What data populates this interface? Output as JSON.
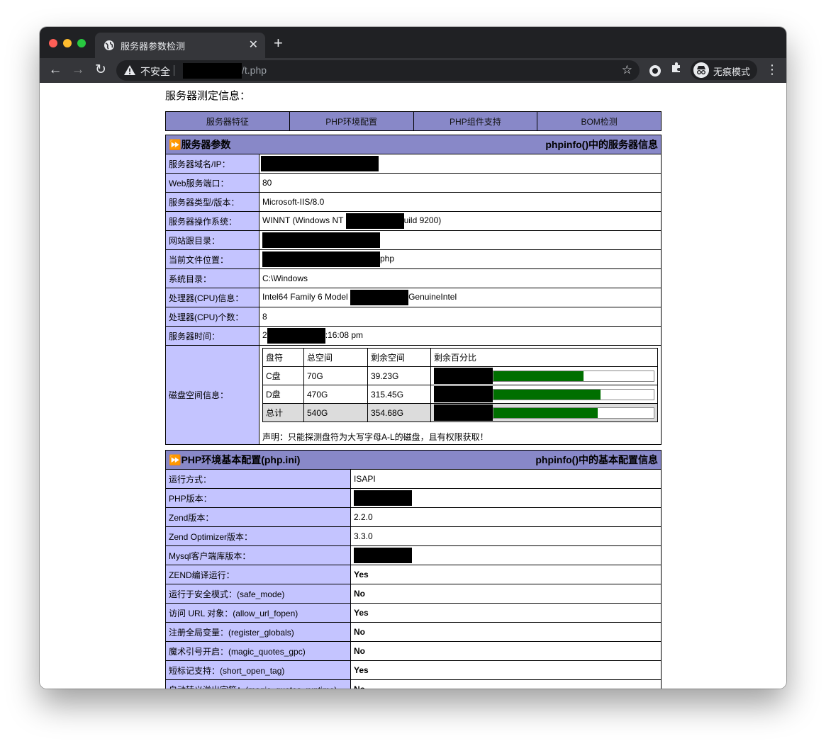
{
  "tab": {
    "title": "服务器参数检测",
    "close": "✕",
    "new_tab": "+"
  },
  "toolbar": {
    "back": "←",
    "forward": "→",
    "reload": "↻",
    "security_label": "不安全",
    "url_path": "/t.php",
    "star": "☆",
    "incognito_label": "无痕模式",
    "menu": "⋮"
  },
  "page": {
    "title": "服务器测定信息：",
    "nav_tabs": [
      "服务器特征",
      "PHP环境配置",
      "PHP组件支持",
      "BOM检测"
    ]
  },
  "server_section": {
    "title": "服务器参数",
    "right_title": "phpinfo()中的服务器信息",
    "rows": [
      {
        "label": "服务器域名/IP：",
        "before": "",
        "after": ""
      },
      {
        "label": "Web服务端口：",
        "before": "80",
        "after": ""
      },
      {
        "label": "服务器类型/版本：",
        "before": "Microsoft-IIS/8.0",
        "after": ""
      },
      {
        "label": "服务器操作系统：",
        "before": "WINNT (Windows NT ",
        "after": "uild 9200)"
      },
      {
        "label": "网站跟目录：",
        "before": "",
        "after": ""
      },
      {
        "label": "当前文件位置：",
        "before": "",
        "after": "php"
      },
      {
        "label": "系统目录：",
        "before": "C:\\Windows",
        "after": ""
      },
      {
        "label": "处理器(CPU)信息：",
        "before": "Intel64 Family 6 Model ",
        "after": "GenuineIntel"
      },
      {
        "label": "处理器(CPU)个数：",
        "before": "8",
        "after": ""
      },
      {
        "label": "服务器时间：",
        "before": "2",
        "after": ":16:08 pm"
      }
    ],
    "disk_label": "磁盘空间信息：",
    "disk_headers": [
      "盘符",
      "总空间",
      "剩余空间",
      "剩余百分比"
    ],
    "disks": [
      {
        "drive": "C盘",
        "total": "70G",
        "free": "39.23G",
        "percent_free": 56
      },
      {
        "drive": "D盘",
        "total": "470G",
        "free": "315.45G",
        "percent_free": 67
      },
      {
        "drive": "总计",
        "total": "540G",
        "free": "354.68G",
        "percent_free": 65
      }
    ],
    "disk_note": "声明：只能探测盘符为大写字母A-L的磁盘，且有权限获取！"
  },
  "php_section": {
    "title": "PHP环境基本配置(php.ini)",
    "right_title": "phpinfo()中的基本配置信息",
    "rows": [
      {
        "label": "运行方式：",
        "value": "ISAPI",
        "status": ""
      },
      {
        "label": "PHP版本：",
        "value": "",
        "status": ""
      },
      {
        "label": "Zend版本：",
        "value": "2.2.0",
        "status": ""
      },
      {
        "label": "Zend Optimizer版本：",
        "value": "3.3.0",
        "status": ""
      },
      {
        "label": "Mysql客户端库版本：",
        "value": "",
        "status": ""
      },
      {
        "label": "ZEND编译运行：",
        "value": "Yes",
        "status": "yes"
      },
      {
        "label": "运行于安全模式：(safe_mode)",
        "value": "No",
        "status": "no"
      },
      {
        "label": "访问 URL 对象：(allow_url_fopen)",
        "value": "Yes",
        "status": "yes"
      },
      {
        "label": "注册全局变量：(register_globals)",
        "value": "No",
        "status": "no"
      },
      {
        "label": "魔术引号开启：(magic_quotes_gpc)",
        "value": "No",
        "status": "no"
      },
      {
        "label": "短标记支持：(short_open_tag)",
        "value": "Yes",
        "status": "yes"
      },
      {
        "label": "自动转义溢出字符：(magic_quotes_runtime)",
        "value": "No",
        "status": "no"
      }
    ]
  },
  "colors": {
    "header_bg": "#8888c8",
    "label_bg": "#c4c4ff",
    "yes": "#007700",
    "no": "#dd0000",
    "bar_fill": "#006f00"
  },
  "icons": [
    "globe-icon",
    "warning-icon",
    "star-icon",
    "record-icon",
    "puzzle-icon",
    "incognito-icon",
    "menu-icon"
  ]
}
